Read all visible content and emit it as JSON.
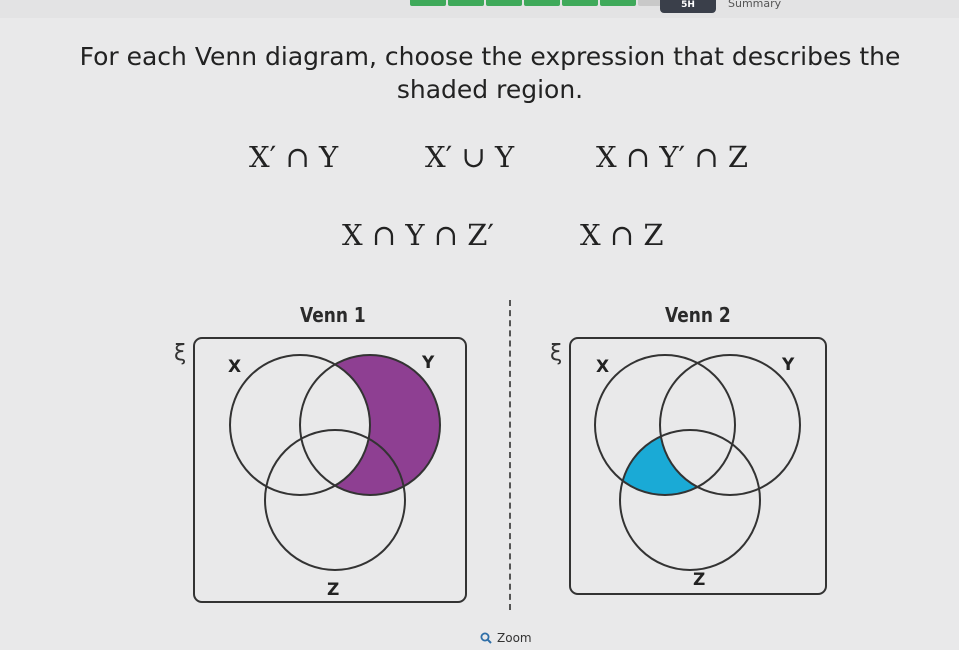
{
  "header": {
    "tab_label": "5H",
    "summary_label": "Summary",
    "progress": [
      {
        "state": "complete"
      },
      {
        "state": "complete"
      },
      {
        "state": "complete"
      },
      {
        "state": "complete"
      },
      {
        "state": "complete"
      },
      {
        "state": "complete"
      },
      {
        "state": "incomplete"
      }
    ]
  },
  "question": {
    "text": "For each Venn diagram, choose the expression that describes the shaded region."
  },
  "options": [
    {
      "label": "X′ ∩ Y"
    },
    {
      "label": "X′ ∪ Y"
    },
    {
      "label": "X ∩ Y′ ∩ Z"
    },
    {
      "label": "X ∩ Y ∩ Z′"
    },
    {
      "label": "X ∩ Z"
    }
  ],
  "venns": [
    {
      "title": "Venn 1",
      "universe_symbol": "ξ",
      "set_labels": {
        "x": "X",
        "y": "Y",
        "z": "Z"
      },
      "shaded_region": "X′ ∩ Y",
      "shade_color": "#8e3f92"
    },
    {
      "title": "Venn 2",
      "universe_symbol": "ξ",
      "set_labels": {
        "x": "X",
        "y": "Y",
        "z": "Z"
      },
      "shaded_region": "X ∩ Y′ ∩ Z",
      "shade_color": "#1aaad6"
    }
  ],
  "footer": {
    "zoom_label": "Zoom",
    "zoom_icon": "magnifier-icon"
  }
}
